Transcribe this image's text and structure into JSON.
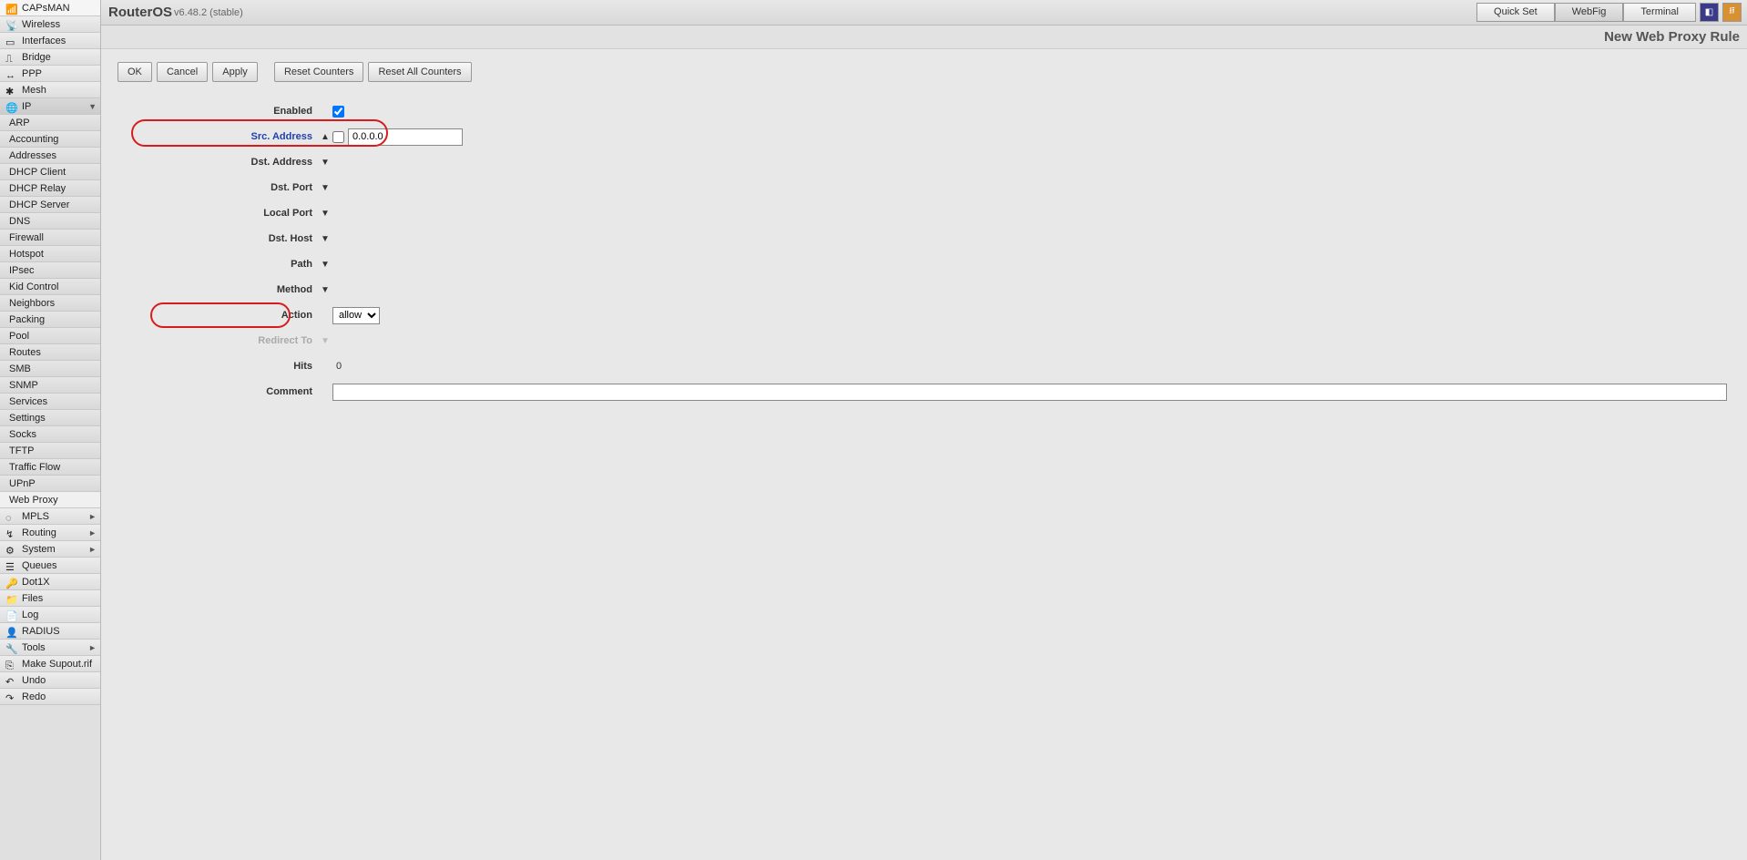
{
  "brand": "RouterOS",
  "version": "v6.48.2 (stable)",
  "top_tabs": {
    "quickset": "Quick Set",
    "webfig": "WebFig",
    "terminal": "Terminal"
  },
  "page_title": "New Web Proxy Rule",
  "sidebar": {
    "main": [
      {
        "label": "CAPsMAN"
      },
      {
        "label": "Wireless"
      },
      {
        "label": "Interfaces"
      },
      {
        "label": "Bridge"
      },
      {
        "label": "PPP"
      },
      {
        "label": "Mesh"
      },
      {
        "label": "IP",
        "expand": "▼",
        "expanded": true
      },
      {
        "label": "MPLS",
        "expand": "►"
      },
      {
        "label": "Routing",
        "expand": "►"
      },
      {
        "label": "System",
        "expand": "►"
      },
      {
        "label": "Queues"
      },
      {
        "label": "Dot1X"
      },
      {
        "label": "Files"
      },
      {
        "label": "Log"
      },
      {
        "label": "RADIUS"
      },
      {
        "label": "Tools",
        "expand": "►"
      },
      {
        "label": "Make Supout.rif"
      },
      {
        "label": "Undo"
      },
      {
        "label": "Redo"
      }
    ],
    "ip_sub": [
      "ARP",
      "Accounting",
      "Addresses",
      "DHCP Client",
      "DHCP Relay",
      "DHCP Server",
      "DNS",
      "Firewall",
      "Hotspot",
      "IPsec",
      "Kid Control",
      "Neighbors",
      "Packing",
      "Pool",
      "Routes",
      "SMB",
      "SNMP",
      "Services",
      "Settings",
      "Socks",
      "TFTP",
      "Traffic Flow",
      "UPnP",
      "Web Proxy"
    ]
  },
  "buttons": {
    "ok": "OK",
    "cancel": "Cancel",
    "apply": "Apply",
    "reset_counters": "Reset Counters",
    "reset_all_counters": "Reset All Counters"
  },
  "form": {
    "enabled_label": "Enabled",
    "src_address_label": "Src. Address",
    "src_address_value": "0.0.0.0",
    "dst_address_label": "Dst. Address",
    "dst_port_label": "Dst. Port",
    "local_port_label": "Local Port",
    "dst_host_label": "Dst. Host",
    "path_label": "Path",
    "method_label": "Method",
    "action_label": "Action",
    "action_value": "allow",
    "redirect_label": "Redirect To",
    "hits_label": "Hits",
    "hits_value": "0",
    "comment_label": "Comment",
    "comment_value": ""
  }
}
